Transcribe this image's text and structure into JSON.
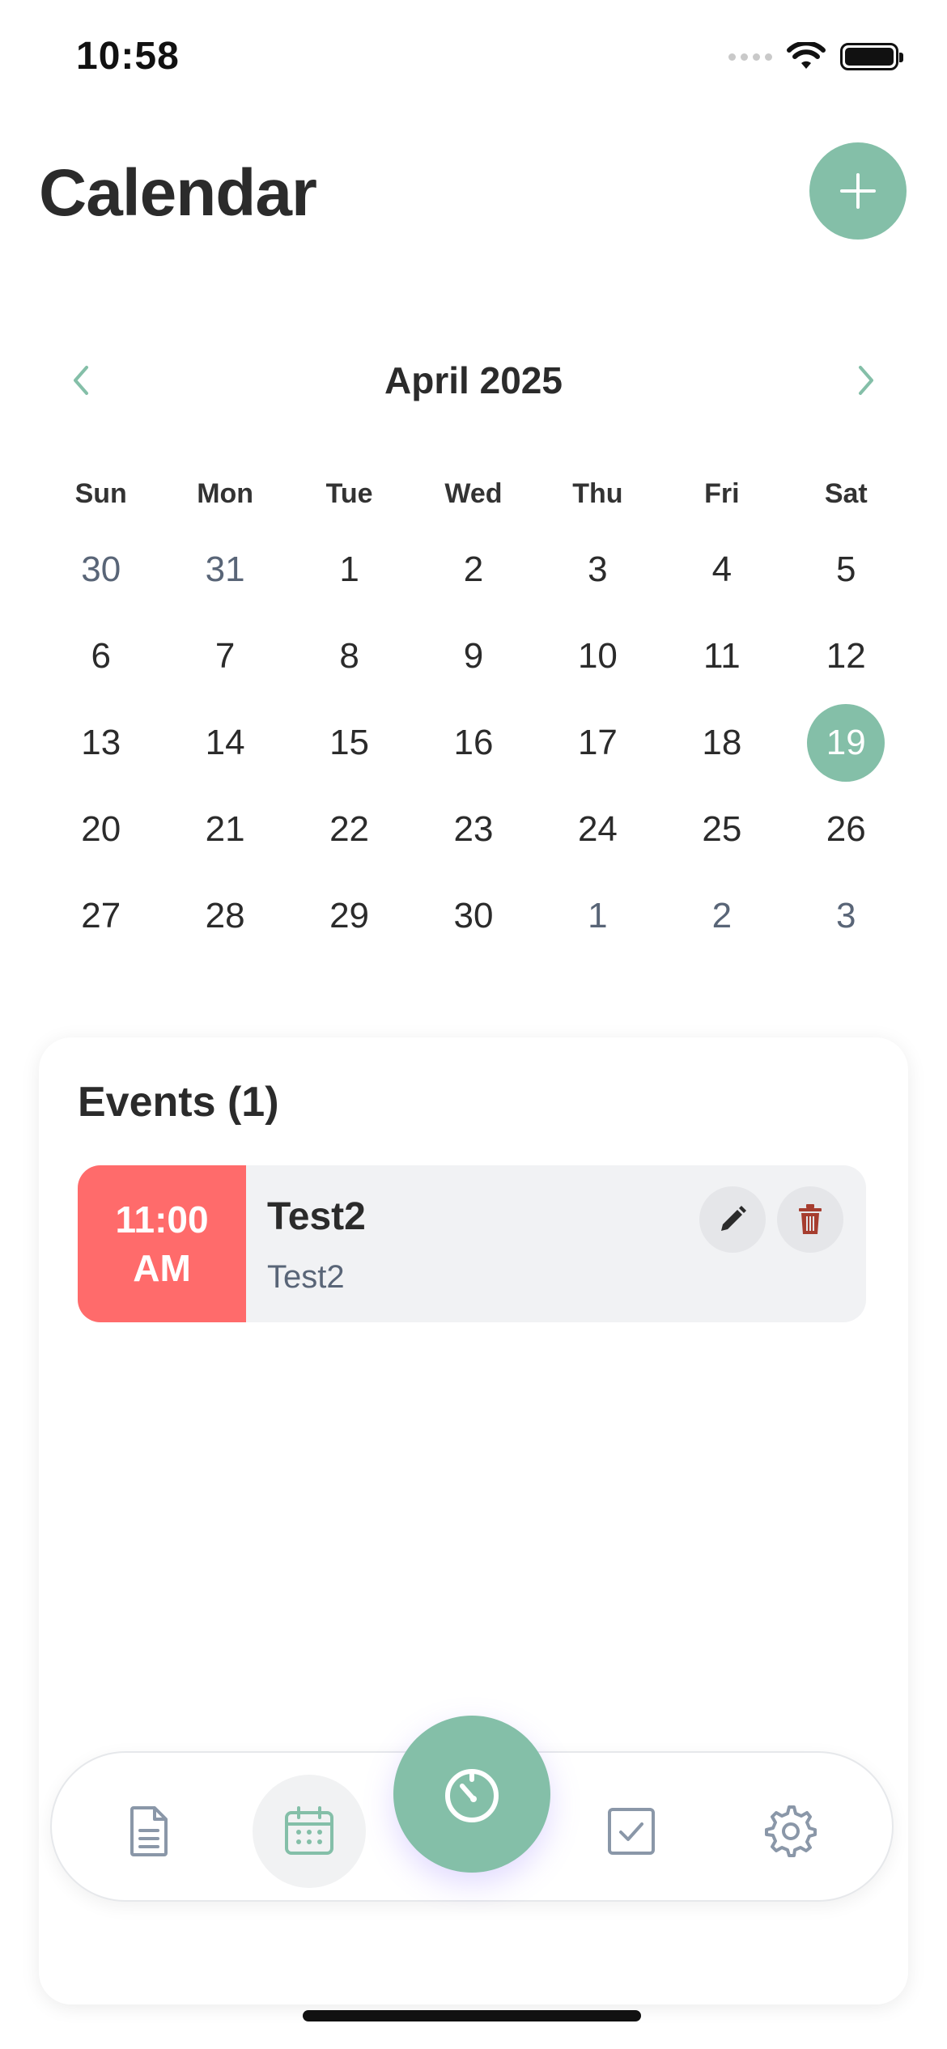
{
  "status_bar": {
    "time": "10:58",
    "icons": [
      "signal-icon",
      "wifi-icon",
      "battery-icon"
    ]
  },
  "header": {
    "title": "Calendar",
    "add_icon": "plus-icon"
  },
  "month_nav": {
    "label": "April 2025",
    "prev_icon": "chevron-left-icon",
    "next_icon": "chevron-right-icon"
  },
  "calendar": {
    "weekdays": [
      "Sun",
      "Mon",
      "Tue",
      "Wed",
      "Thu",
      "Fri",
      "Sat"
    ],
    "days": [
      {
        "label": "30",
        "muted": true
      },
      {
        "label": "31",
        "muted": true
      },
      {
        "label": "1"
      },
      {
        "label": "2"
      },
      {
        "label": "3"
      },
      {
        "label": "4"
      },
      {
        "label": "5"
      },
      {
        "label": "6"
      },
      {
        "label": "7"
      },
      {
        "label": "8"
      },
      {
        "label": "9"
      },
      {
        "label": "10"
      },
      {
        "label": "11"
      },
      {
        "label": "12"
      },
      {
        "label": "13"
      },
      {
        "label": "14"
      },
      {
        "label": "15"
      },
      {
        "label": "16"
      },
      {
        "label": "17"
      },
      {
        "label": "18"
      },
      {
        "label": "19",
        "selected": true
      },
      {
        "label": "20"
      },
      {
        "label": "21"
      },
      {
        "label": "22"
      },
      {
        "label": "23"
      },
      {
        "label": "24"
      },
      {
        "label": "25"
      },
      {
        "label": "26"
      },
      {
        "label": "27"
      },
      {
        "label": "28"
      },
      {
        "label": "29"
      },
      {
        "label": "30"
      },
      {
        "label": "1",
        "muted": true
      },
      {
        "label": "2",
        "muted": true
      },
      {
        "label": "3",
        "muted": true
      }
    ]
  },
  "events": {
    "title": "Events (1)",
    "items": [
      {
        "time_line1": "11:00",
        "time_line2": "AM",
        "title": "Test2",
        "description": "Test2",
        "edit_icon": "pencil-icon",
        "delete_icon": "trash-icon"
      }
    ]
  },
  "tab_bar": {
    "tabs": [
      {
        "name": "notes",
        "icon": "document-icon",
        "active": false
      },
      {
        "name": "calendar",
        "icon": "calendar-icon",
        "active": true
      },
      {
        "name": "timer",
        "icon": "timer-icon",
        "active": false
      },
      {
        "name": "tasks",
        "icon": "checkbox-icon",
        "active": false
      },
      {
        "name": "settings",
        "icon": "gear-icon",
        "active": false
      }
    ]
  },
  "colors": {
    "accent": "#84bfa8",
    "event_time": "#ff6b6b",
    "muted_text": "#596577",
    "delete_icon": "#a63d2f",
    "tab_icon": "#8a97a8"
  }
}
